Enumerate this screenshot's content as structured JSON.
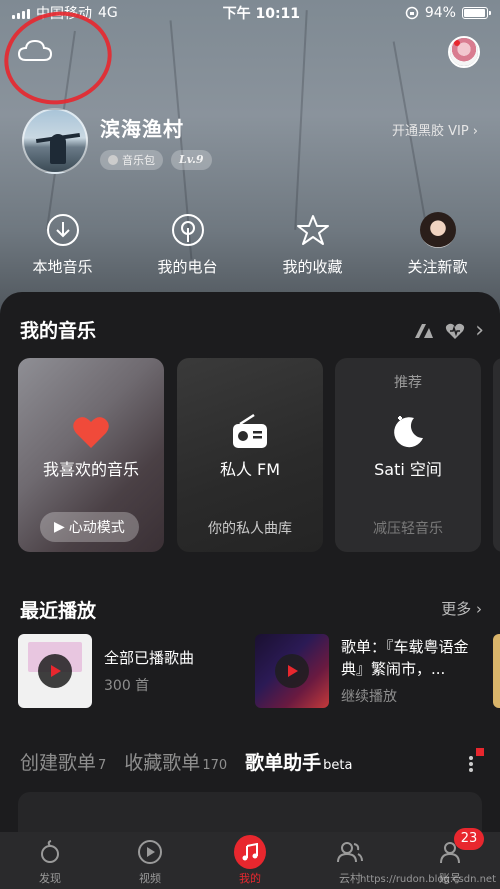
{
  "status_bar": {
    "carrier": "中国移动",
    "network": "4G",
    "time": "下午 10:11",
    "battery_text": "94%",
    "battery_level": 0.94
  },
  "header": {
    "cloud_icon": "cloud-icon",
    "username": "滨海渔村",
    "music_pack_badge": "音乐包",
    "level_badge": "Lv.9",
    "vip_link": "开通黑胶 VIP"
  },
  "quick_actions": [
    {
      "label": "本地音乐",
      "icon": "download-circle-icon"
    },
    {
      "label": "我的电台",
      "icon": "radio-podcast-icon"
    },
    {
      "label": "我的收藏",
      "icon": "star-icon"
    },
    {
      "label": "关注新歌",
      "icon": "artist-avatar"
    }
  ],
  "my_music": {
    "title": "我的音乐",
    "cards": [
      {
        "label": "我喜欢的音乐",
        "action": "心动模式"
      },
      {
        "label": "私人 FM",
        "sub": "你的私人曲库"
      },
      {
        "top": "推荐",
        "label": "Sati 空间",
        "sub": "减压轻音乐"
      }
    ]
  },
  "recent": {
    "title": "最近播放",
    "more": "更多",
    "items": [
      {
        "name": "全部已播歌曲",
        "sub": "300 首"
      },
      {
        "name": "歌单：『车载粤语金典』繁闹市，...",
        "sub": "继续播放"
      }
    ]
  },
  "playlist_tabs": [
    {
      "label": "创建歌单",
      "count": "7"
    },
    {
      "label": "收藏歌单",
      "count": "170"
    },
    {
      "label": "歌单助手",
      "count": "beta"
    }
  ],
  "bottom_nav": [
    {
      "label": "发现",
      "icon": "discover-icon"
    },
    {
      "label": "视频",
      "icon": "video-icon"
    },
    {
      "label": "我的",
      "icon": "music-note-icon"
    },
    {
      "label": "云村",
      "icon": "community-icon"
    },
    {
      "label": "账号",
      "icon": "account-icon",
      "badge": "23"
    }
  ],
  "watermark": "https://rudon.blog.csdn.net",
  "colors": {
    "accent": "#e8272e",
    "panel": "#1c1c1e"
  }
}
